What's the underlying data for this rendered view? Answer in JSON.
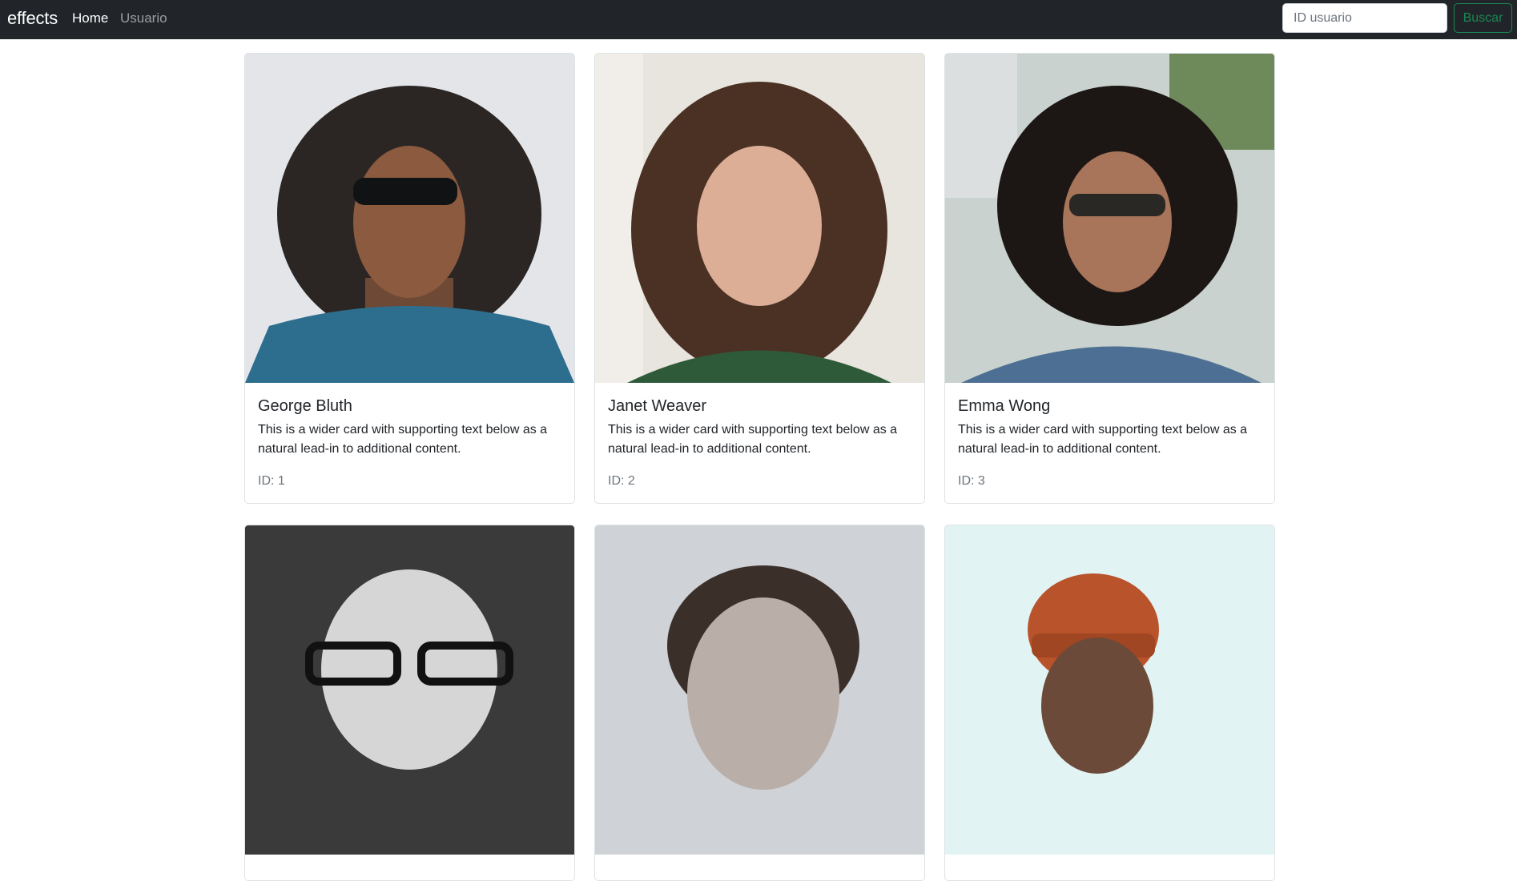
{
  "navbar": {
    "brand": "effects",
    "links": [
      {
        "label": "Home",
        "active": true
      },
      {
        "label": "Usuario",
        "active": false
      }
    ],
    "search": {
      "placeholder": "ID usuario",
      "value": ""
    },
    "search_button_label": "Buscar"
  },
  "colors": {
    "navbar_bg": "#212529",
    "success": "#198754",
    "muted": "#6c757d"
  },
  "users": [
    {
      "name": "George Bluth",
      "text": "This is a wider card with supporting text below as a natural lead-in to additional content.",
      "id_label": "ID: 1"
    },
    {
      "name": "Janet Weaver",
      "text": "This is a wider card with supporting text below as a natural lead-in to additional content.",
      "id_label": "ID: 2"
    },
    {
      "name": "Emma Wong",
      "text": "This is a wider card with supporting text below as a natural lead-in to additional content.",
      "id_label": "ID: 3"
    },
    {
      "name": "",
      "text": "",
      "id_label": ""
    },
    {
      "name": "",
      "text": "",
      "id_label": ""
    },
    {
      "name": "",
      "text": "",
      "id_label": ""
    }
  ]
}
